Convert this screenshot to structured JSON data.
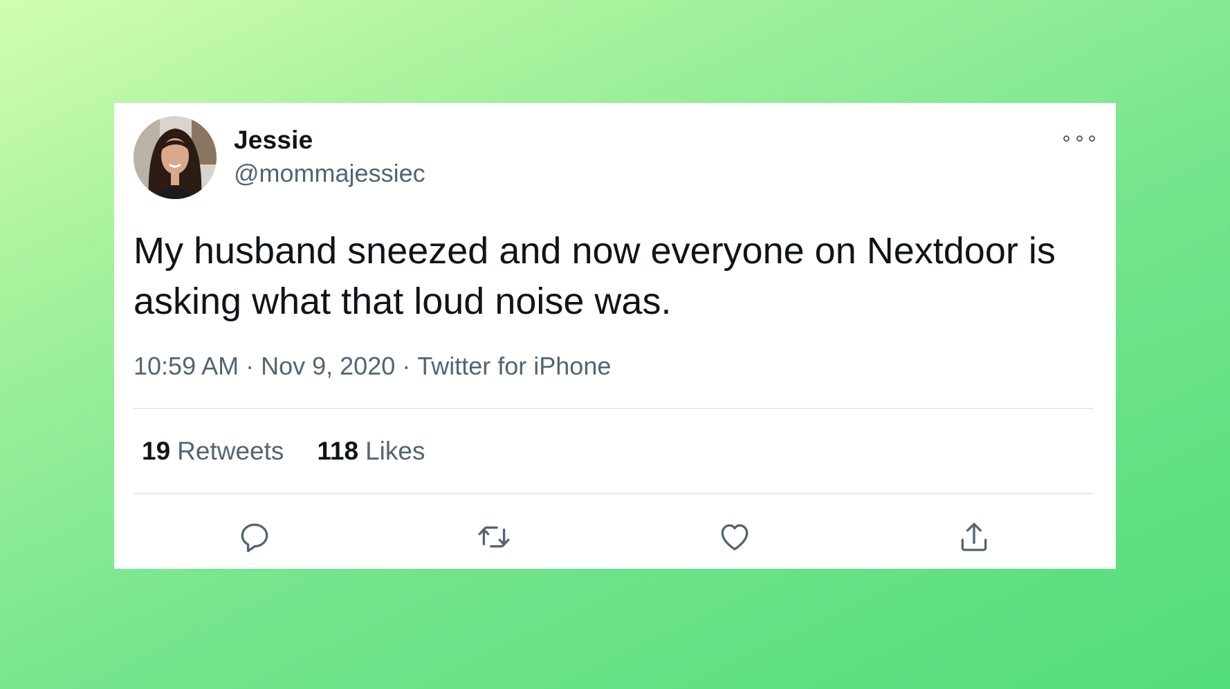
{
  "tweet": {
    "author": {
      "name": "Jessie",
      "handle": "@mommajessiec"
    },
    "text": "My husband sneezed and now everyone on Nextdoor is asking what that loud noise was.",
    "time": "10:59 AM",
    "date": "Nov 9, 2020",
    "separator": "·",
    "source": "Twitter for iPhone",
    "stats": {
      "retweets_count": "19",
      "retweets_label": "Retweets",
      "likes_count": "118",
      "likes_label": "Likes"
    },
    "actions": [
      {
        "name": "reply",
        "icon": "reply-icon"
      },
      {
        "name": "retweet",
        "icon": "retweet-icon"
      },
      {
        "name": "like",
        "icon": "heart-icon"
      },
      {
        "name": "share",
        "icon": "share-icon"
      }
    ],
    "more_icon": "more-options-icon"
  },
  "colors": {
    "background_gradient_start": "#d2fdb2",
    "background_gradient_end": "#52dc7c",
    "card": "#ffffff",
    "text_primary": "#0f1419",
    "text_secondary": "#536471",
    "divider": "#e6e9eb"
  }
}
